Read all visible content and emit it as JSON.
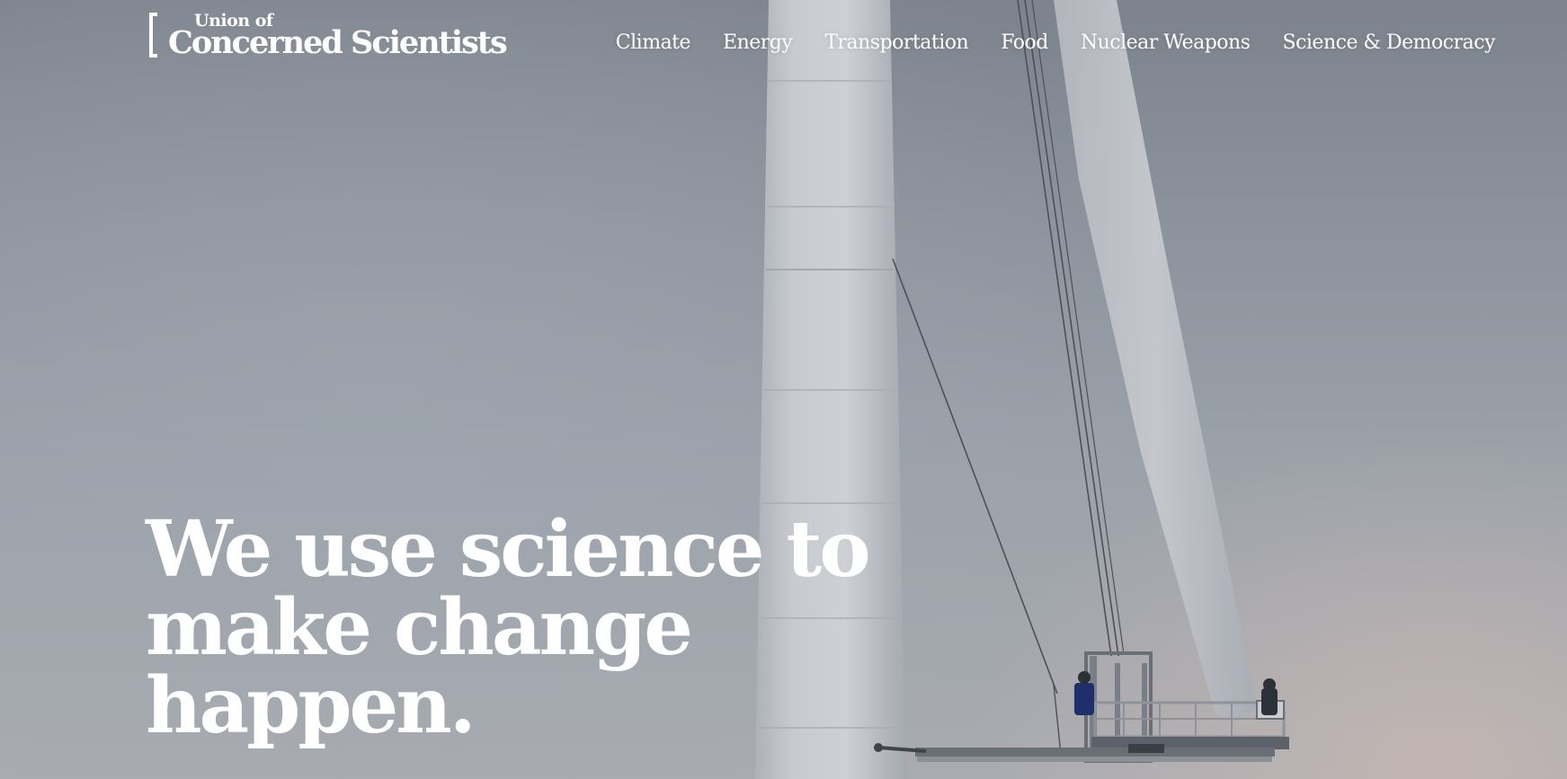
{
  "brand": {
    "logo_line1": "Union of",
    "logo_line2": "Concerned Scientists"
  },
  "nav": {
    "items": [
      {
        "label": "Climate"
      },
      {
        "label": "Energy"
      },
      {
        "label": "Transportation"
      },
      {
        "label": "Food"
      },
      {
        "label": "Nuclear Weapons"
      },
      {
        "label": "Science & Democracy"
      }
    ]
  },
  "hero": {
    "headline_lines": [
      "We use science to",
      "make change",
      "happen."
    ],
    "image_subject": "wind-turbine-maintenance-photo"
  },
  "colors": {
    "text": "#ffffff",
    "sky": "#8d939c",
    "tower": "#c9ccd0"
  }
}
